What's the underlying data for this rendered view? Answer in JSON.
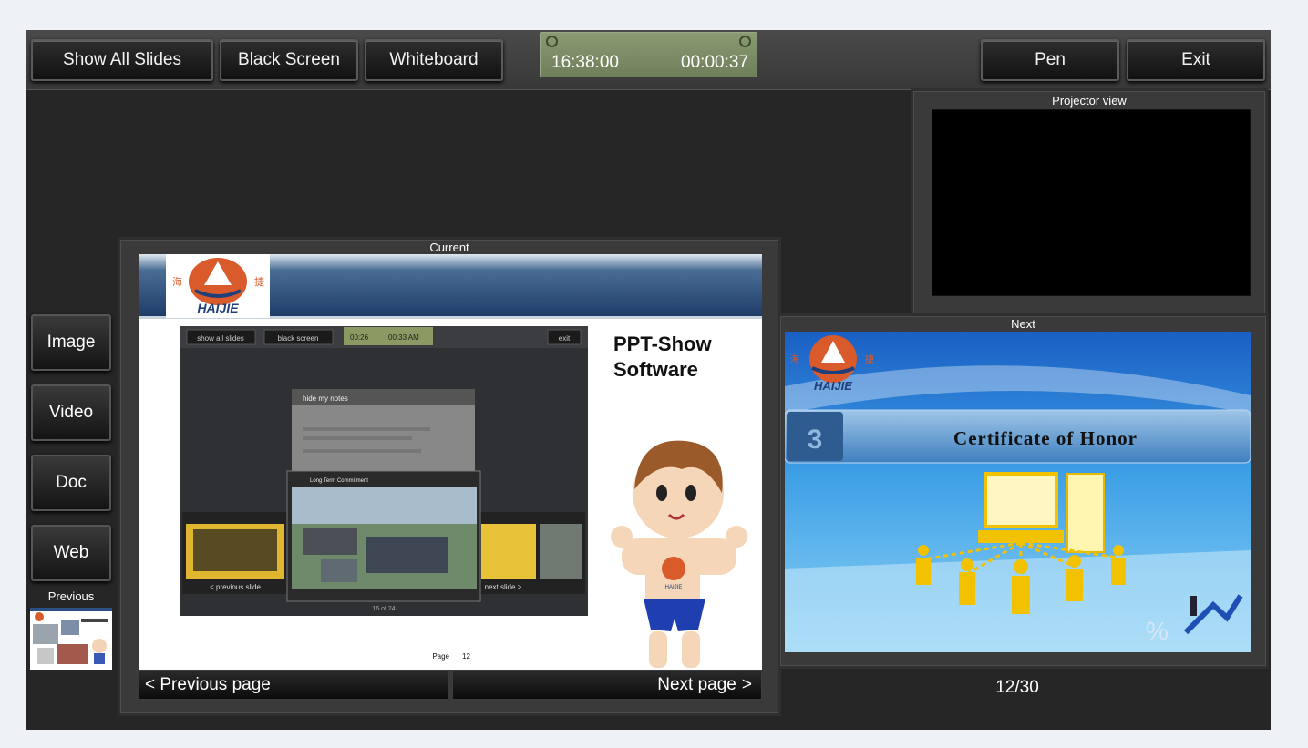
{
  "toolbar": {
    "show_all_slides": "Show All Slides",
    "black_screen": "Black Screen",
    "whiteboard": "Whiteboard",
    "pen": "Pen",
    "exit": "Exit"
  },
  "clock": {
    "current_time": "16:38:00",
    "elapsed": "00:00:37",
    "left_icon": "alarm-clock-icon",
    "right_icon": "stopwatch-icon"
  },
  "sidebar": {
    "image": "Image",
    "video": "Video",
    "doc": "Doc",
    "web": "Web"
  },
  "previous": {
    "label": "Previous"
  },
  "current": {
    "label": "Current",
    "slide": {
      "logo_text": "HAIJIE",
      "logo_left_char": "海",
      "logo_right_char": "捷",
      "title_line1": "PPT-Show",
      "title_line2": "Software",
      "page_label": "Page",
      "page_number": "12",
      "screenshot": {
        "show_all_slides": "show all slides",
        "black_screen": "black screen",
        "time1": "00:26",
        "time2": "00:33 AM",
        "exit": "exit",
        "hide_notes": "hide my notes",
        "card_title": "Long Term Commitment",
        "prev_slide": "< previous slide",
        "next_slide": "next slide >",
        "counter": "16 of 24"
      }
    }
  },
  "nav": {
    "previous_page": "< Previous page",
    "next_page": "Next page"
  },
  "projector": {
    "label": "Projector view"
  },
  "next": {
    "label": "Next",
    "slide": {
      "logo_text": "HAIJIE",
      "logo_left_char": "海",
      "logo_right_char": "捷",
      "banner_number": "3",
      "title": "Certificate of Honor"
    }
  },
  "counter": "12/30"
}
